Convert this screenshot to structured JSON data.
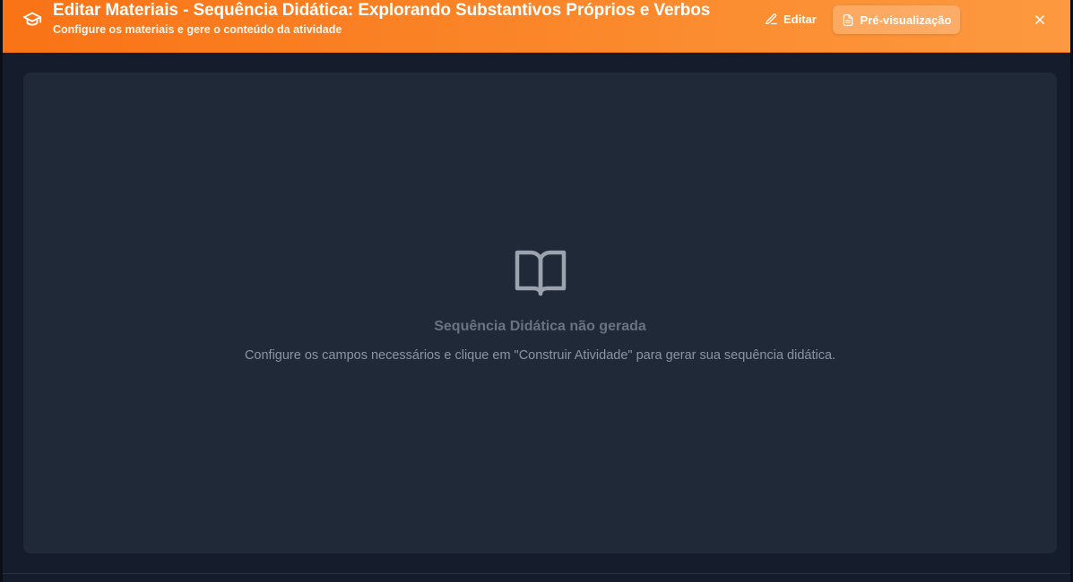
{
  "header": {
    "title": "Editar Materiais - Sequência Didática: Explorando Substantivos Próprios e Verbos",
    "subtitle": "Configure os materiais e gere o conteúdo da atividade",
    "icon": "graduation-cap-icon",
    "edit_label": "Editar",
    "preview_label": "Pré-visualização",
    "accent_color": "#f97316"
  },
  "main": {
    "empty_state": {
      "icon": "open-book-icon",
      "title": "Sequência Didática não gerada",
      "description": "Configure os campos necessários e clique em \"Construir Atividade\" para gerar sua sequência didática."
    }
  }
}
